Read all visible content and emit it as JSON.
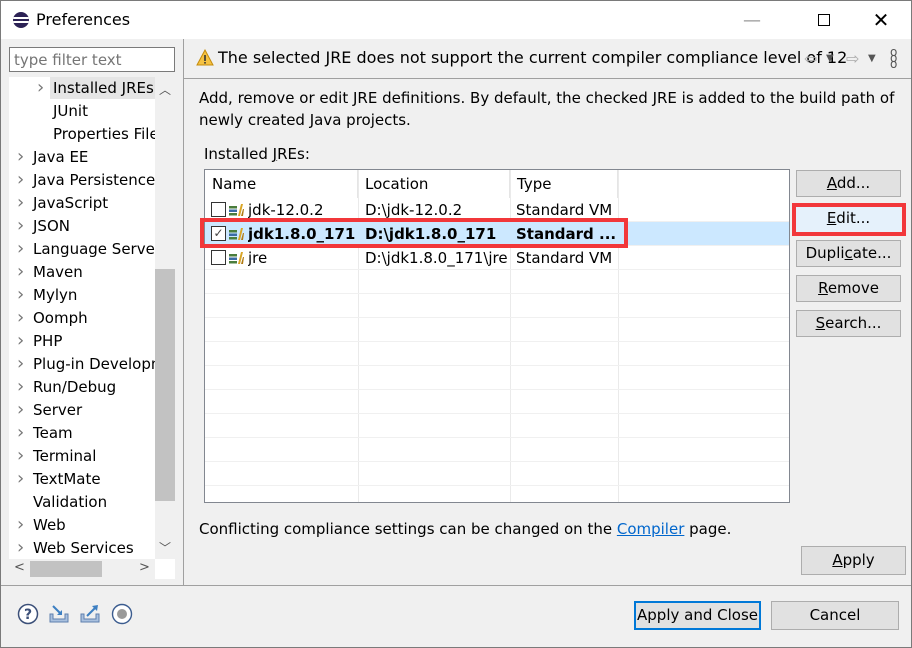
{
  "window": {
    "title": "Preferences",
    "controls": {
      "minimize": "—",
      "close": "✕"
    }
  },
  "filter": {
    "placeholder": "type filter text",
    "value": ""
  },
  "tree": {
    "items": [
      {
        "label": "Installed JREs",
        "indent": 2,
        "has_children": true,
        "selected": true
      },
      {
        "label": "JUnit",
        "indent": 2,
        "has_children": false
      },
      {
        "label": "Properties File",
        "indent": 2,
        "has_children": false
      },
      {
        "label": "Java EE",
        "indent": 1,
        "has_children": true
      },
      {
        "label": "Java Persistence",
        "indent": 1,
        "has_children": true
      },
      {
        "label": "JavaScript",
        "indent": 1,
        "has_children": true
      },
      {
        "label": "JSON",
        "indent": 1,
        "has_children": true
      },
      {
        "label": "Language Server",
        "indent": 1,
        "has_children": true
      },
      {
        "label": "Maven",
        "indent": 1,
        "has_children": true
      },
      {
        "label": "Mylyn",
        "indent": 1,
        "has_children": true
      },
      {
        "label": "Oomph",
        "indent": 1,
        "has_children": true
      },
      {
        "label": "PHP",
        "indent": 1,
        "has_children": true
      },
      {
        "label": "Plug-in Development",
        "indent": 1,
        "has_children": true
      },
      {
        "label": "Run/Debug",
        "indent": 1,
        "has_children": true
      },
      {
        "label": "Server",
        "indent": 1,
        "has_children": true
      },
      {
        "label": "Team",
        "indent": 1,
        "has_children": true
      },
      {
        "label": "Terminal",
        "indent": 1,
        "has_children": true
      },
      {
        "label": "TextMate",
        "indent": 1,
        "has_children": true
      },
      {
        "label": "Validation",
        "indent": 1,
        "has_children": false
      },
      {
        "label": "Web",
        "indent": 1,
        "has_children": true
      },
      {
        "label": "Web Services",
        "indent": 1,
        "has_children": true
      }
    ]
  },
  "message": {
    "icon": "warning-icon",
    "text": "The selected JRE does not support the current compiler compliance level of 12",
    "nav": {
      "back": "⇦",
      "forward": "⇨",
      "dropdown": "▼",
      "menu": "⋮"
    }
  },
  "page": {
    "description": "Add, remove or edit JRE definitions. By default, the checked JRE is added to the build path of newly created Java projects.",
    "installed_label_pre": "Installed ",
    "installed_label_mnemonic": "J",
    "installed_label_post": "REs:",
    "table": {
      "columns": [
        "Name",
        "Location",
        "Type"
      ],
      "rows": [
        {
          "checked": false,
          "name": "jdk-12.0.2",
          "location": "D:\\jdk-12.0.2",
          "type": "Standard VM",
          "selected": false
        },
        {
          "checked": true,
          "name": "jdk1.8.0_171...",
          "location": "D:\\jdk1.8.0_171",
          "type": "Standard ...",
          "selected": true
        },
        {
          "checked": false,
          "name": "jre",
          "location": "D:\\jdk1.8.0_171\\jre",
          "type": "Standard VM",
          "selected": false
        }
      ]
    },
    "buttons": {
      "add": {
        "mn": "A",
        "rest": "dd..."
      },
      "edit": {
        "mn": "E",
        "rest": "dit..."
      },
      "duplicate": {
        "pre": "Dupli",
        "mn": "c",
        "rest": "ate..."
      },
      "remove": {
        "mn": "R",
        "rest": "emove"
      },
      "search": {
        "mn": "S",
        "rest": "earch..."
      }
    },
    "conflict_pre": "Conflicting compliance settings can be changed on the ",
    "conflict_link": "Compiler",
    "conflict_post": " page.",
    "apply": {
      "mn": "A",
      "rest": "pply"
    }
  },
  "footer": {
    "apply_and_close": "Apply and Close",
    "cancel": "Cancel",
    "icons": [
      "help-icon",
      "import-icon",
      "export-icon",
      "record-icon"
    ]
  },
  "colors": {
    "highlight_annotation": "#f2373a",
    "selection": "#cce8ff",
    "link": "#0066cc",
    "default_button_border": "#0078d7"
  }
}
